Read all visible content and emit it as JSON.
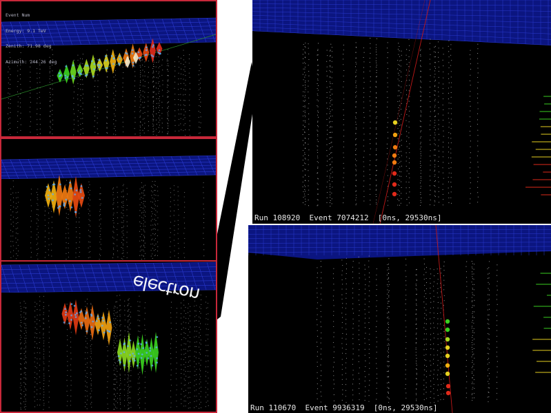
{
  "left_panels": {
    "top_info": [
      "Event Num",
      "Energy: 9.1 TeV",
      "Zenith: 71.98 deg",
      "Azimuth: 244.26 deg"
    ]
  },
  "right_panels": {
    "top_label": "Run 108920  Event 7074212  [0ns, 29530ns]",
    "bottom_label": "Run 110670  Event 9936319  [0ns, 29530ns]"
  },
  "overlay": {
    "label_a": "uoɹʇɔǝןǝ",
    "label_b": "electron"
  },
  "colors": {
    "frame_border": "#c8283a",
    "background": "#000000",
    "ice_grid": "#1a2ab0",
    "hit_red": "#e02a1a",
    "hit_orange": "#f07a10",
    "hit_yellow": "#e6d020",
    "hit_green": "#3ad020",
    "track_line": "#c01818"
  },
  "icons": [
    "dom-string-markers",
    "ice-surface-grid",
    "muon-track-line",
    "cascade-hits"
  ]
}
